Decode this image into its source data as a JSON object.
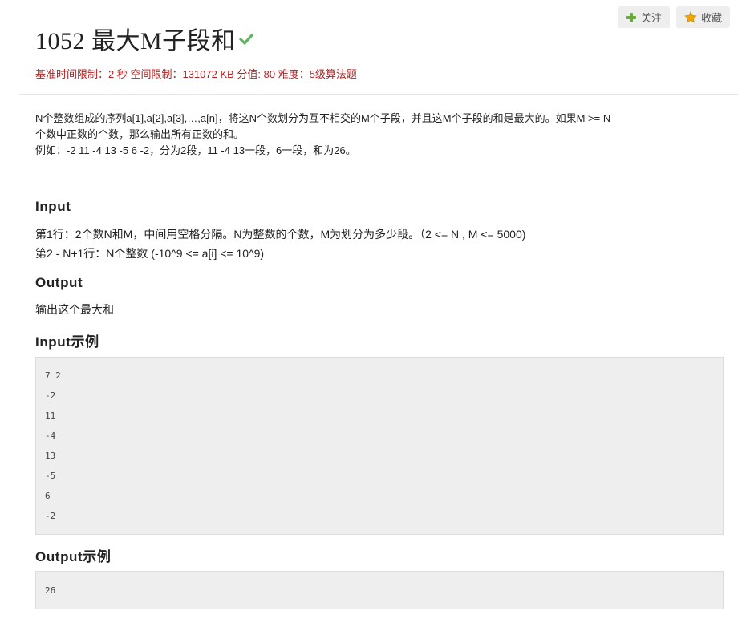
{
  "problem": {
    "title": "1052 最大M子段和",
    "meta": "基准时间限制：2 秒 空间限制：131072 KB 分值: 80 难度：5级算法题"
  },
  "actions": {
    "follow_label": "关注",
    "favorite_label": "收藏"
  },
  "statement": {
    "lines": [
      "N个整数组成的序列a[1],a[2],a[3],…,a[n]，将这N个数划分为互不相交的M个子段，并且这M个子段的和是最大的。如果M >= N",
      "个数中正数的个数，那么输出所有正数的和。",
      "例如：-2 11 -4 13 -5 6 -2，分为2段，11 -4 13一段，6一段，和为26。"
    ]
  },
  "input": {
    "title": "Input",
    "lines": [
      "第1行：2个数N和M，中间用空格分隔。N为整数的个数，M为划分为多少段。（2 <= N , M <= 5000)",
      "第2 - N+1行：N个整数 (-10^9 <= a[i] <= 10^9)"
    ]
  },
  "output": {
    "title": "Output",
    "text": "输出这个最大和"
  },
  "input_example": {
    "title": "Input示例",
    "lines": [
      "7 2",
      "-2",
      "11",
      "-4",
      "13",
      "-5",
      "6",
      "-2"
    ]
  },
  "output_example": {
    "title": "Output示例",
    "lines": [
      "26"
    ]
  },
  "colors": {
    "meta_text": "#b22222",
    "solved_check": "#5cb85c",
    "code_background": "#eeeeee"
  },
  "icons": {
    "solved": "check-icon",
    "follow": "plus-icon",
    "favorite": "star-icon"
  }
}
